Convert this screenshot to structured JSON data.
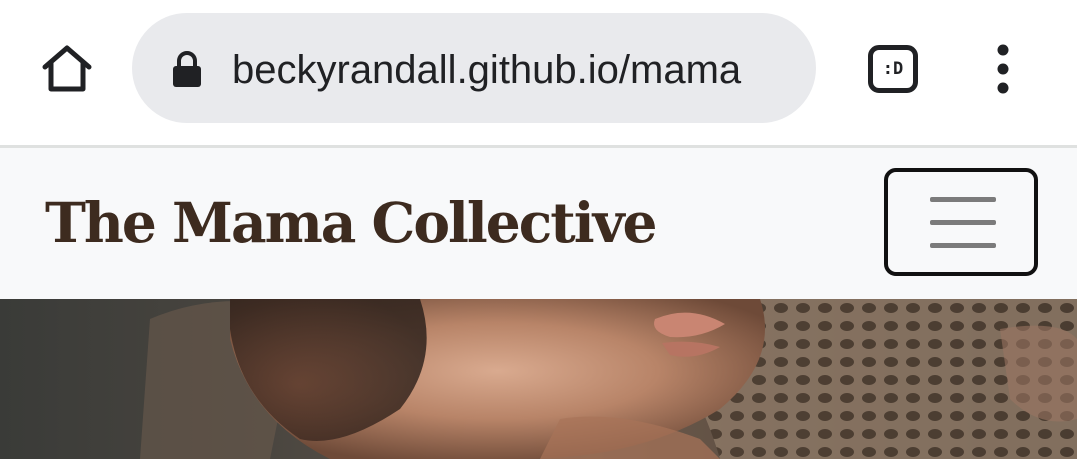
{
  "browser": {
    "url": "beckyrandall.github.io/mama",
    "tab_switcher_label": ":D",
    "icons": {
      "home": "home-icon",
      "lock": "lock-icon",
      "tabs": "tab-switcher-icon",
      "menu": "more-vert-icon"
    }
  },
  "site": {
    "brand": "The Mama Collective",
    "nav_toggle_icon": "hamburger-menu-icon",
    "brand_color": "#3d2b1f",
    "navbar_background": "#f8f9fa"
  },
  "hero": {
    "image_subject": "baby-photo"
  }
}
